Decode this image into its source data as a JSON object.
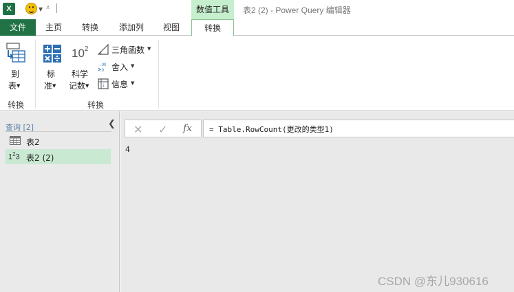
{
  "window": {
    "title": "表2 (2) - Power Query 编辑器",
    "app_icon_letter": "X",
    "context_tab_header": "数值工具"
  },
  "ribbon_tabs": [
    {
      "label": "文件"
    },
    {
      "label": "主页"
    },
    {
      "label": "转换"
    },
    {
      "label": "添加列"
    },
    {
      "label": "视图"
    },
    {
      "label": "转换"
    }
  ],
  "ribbon": {
    "to_table_line1": "到",
    "to_table_line2": "表",
    "standard_line1": "标",
    "standard_line2": "准",
    "scientific_icon_base": "10",
    "scientific_icon_exp": "2",
    "scientific_line1": "科学",
    "scientific_line2": "记数",
    "trig": "三角函数",
    "round": "舍入",
    "info": "信息",
    "group_convert": "转换",
    "group_transform": "转换"
  },
  "queries": {
    "header": "查询 [2]",
    "items": [
      {
        "label": "表2",
        "icon": "table-icon"
      },
      {
        "label": "表2 (2)",
        "icon": "number-type-icon"
      }
    ]
  },
  "formula_bar": {
    "cancel": "✕",
    "confirm": "✓",
    "fx": "fx",
    "formula": "= Table.RowCount(更改的类型1)"
  },
  "result": {
    "value": "4"
  },
  "watermark": "CSDN @东儿930616",
  "colors": {
    "file_tab": "#217346",
    "context_tab": "#c6efce",
    "selected_query": "#c9e9d3"
  }
}
